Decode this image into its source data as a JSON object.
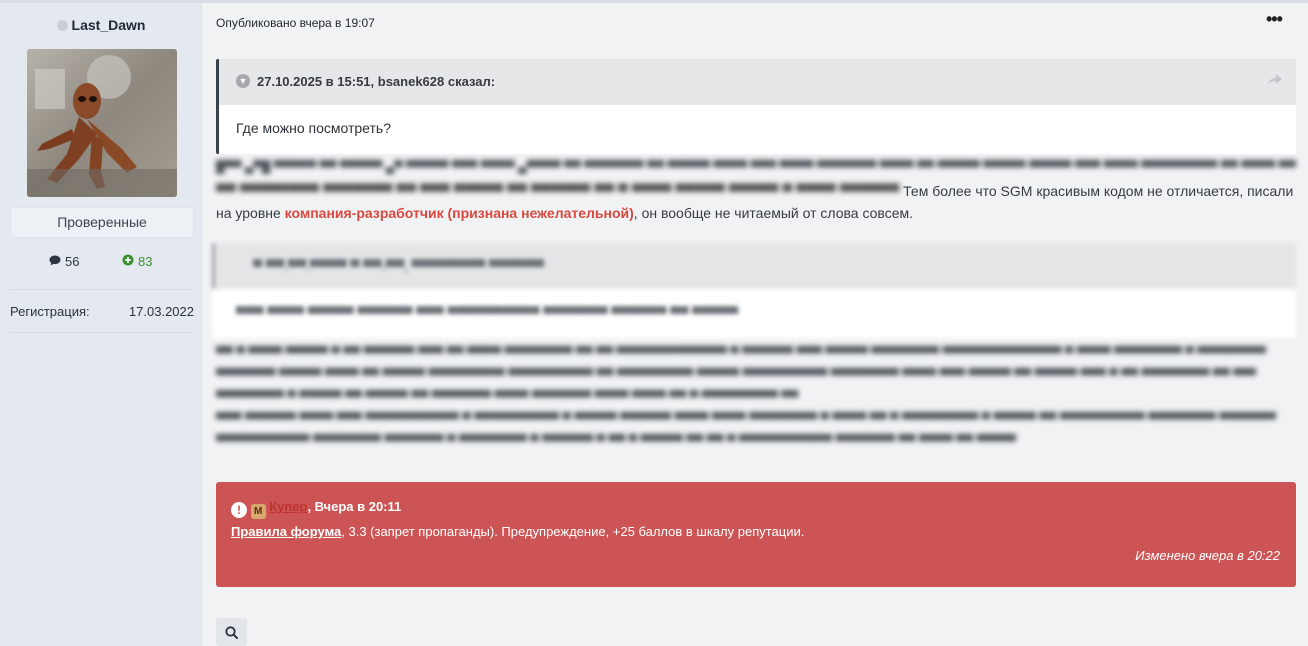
{
  "author": {
    "name": "Last_Dawn",
    "group": "Проверенные",
    "posts_count": "56",
    "reputation": "83",
    "registration_label": "Регистрация:",
    "registration_date": "17.03.2022"
  },
  "post": {
    "meta": "Опубликовано вчера в 19:07",
    "quote": {
      "citation": "27.10.2025 в 15:51, bsanek628 сказал:",
      "text": "Где можно посмотреть?"
    },
    "text_after": "Тем более что SGM красивым кодом не отличается, писали",
    "text_line2_prefix": "на уровне ",
    "highlight": "компания-разработчик (признана нежелательной)",
    "text_line2_suffix": ", он вообще не читаемый от слова совсем."
  },
  "moderator_note": {
    "moderator": "Купер",
    "time": ", Вчера в 20:11",
    "rules_link": "Правила форума",
    "text": ", 3.3 (запрет пропаганды). Предупреждение, +25 баллов в шкалу репутации.",
    "edited": "Изменено вчера в 20:22",
    "color": "#cd5454"
  },
  "icons": {
    "more": "ellipsis-icon",
    "search": "search-icon",
    "posts": "comment-icon",
    "reputation": "plus-circle-icon"
  }
}
